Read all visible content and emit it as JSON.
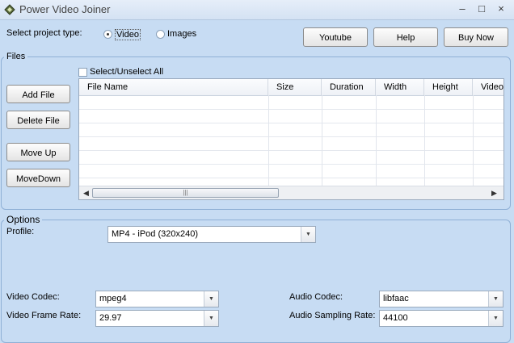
{
  "window": {
    "title": "Power Video Joiner",
    "controls": {
      "minimize": "–",
      "maximize": "□",
      "close": "×"
    }
  },
  "project_type": {
    "label": "Select project type:",
    "options": [
      {
        "label": "Video",
        "selected": true
      },
      {
        "label": "Images",
        "selected": false
      }
    ]
  },
  "top_buttons": {
    "youtube": "Youtube",
    "help": "Help",
    "buy_now": "Buy Now"
  },
  "files": {
    "legend": "Files",
    "select_all": "Select/Unselect All",
    "buttons": {
      "add_file": "Add File",
      "delete_file": "Delete File",
      "move_up": "Move Up",
      "move_down": "MoveDown"
    },
    "columns": [
      "File Name",
      "Size",
      "Duration",
      "Width",
      "Height",
      "Video"
    ],
    "scroll": {
      "left": "◀",
      "right": "▶",
      "grip": "|||"
    }
  },
  "options": {
    "legend": "Options",
    "profile_label": "Profile:",
    "profile_value": "MP4 - iPod (320x240)",
    "video_codec_label": "Video Codec:",
    "video_codec_value": "mpeg4",
    "video_frame_rate_label": "Video Frame Rate:",
    "video_frame_rate_value": "29.97",
    "audio_codec_label": "Audio Codec:",
    "audio_codec_value": "libfaac",
    "audio_sampling_rate_label": "Audio Sampling Rate:",
    "audio_sampling_rate_value": "44100",
    "dropdown_arrow": "▼"
  },
  "colors": {
    "background": "#c7dcf3",
    "group_border": "#8fb0d6"
  }
}
